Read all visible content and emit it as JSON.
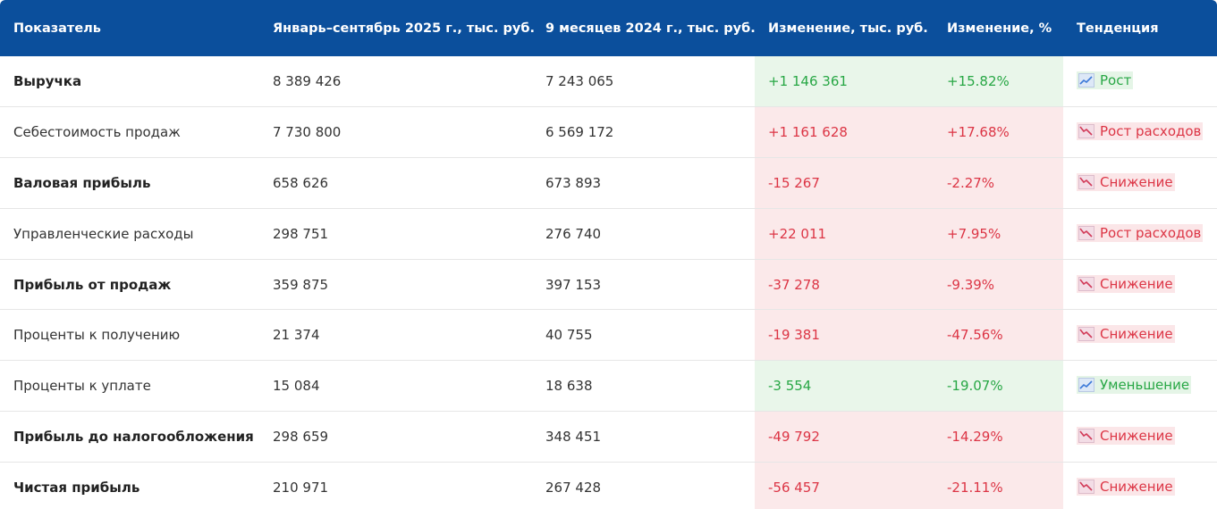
{
  "header": {
    "col_indicator": "Показатель",
    "col_2025": "Январь–сентябрь 2025 г., тыс. руб.",
    "col_2024": "9 месяцев 2024 г., тыс. руб.",
    "col_change_abs": "Изменение, тыс. руб.",
    "col_change_pct": "Изменение, %",
    "col_trend": "Тенденция"
  },
  "rows": [
    {
      "name": "Выручка",
      "bold": true,
      "v2025": "8 389 426",
      "v2024": "7 243 065",
      "abs": "+1 146 361",
      "pct": "+15.82%",
      "trend": "Рост",
      "tone": "up",
      "icon": "chart-increasing-icon"
    },
    {
      "name": "Себестоимость продаж",
      "bold": false,
      "v2025": "7 730 800",
      "v2024": "6 569 172",
      "abs": "+1 161 628",
      "pct": "+17.68%",
      "trend": "Рост расходов",
      "tone": "down",
      "icon": "chart-decreasing-icon"
    },
    {
      "name": "Валовая прибыль",
      "bold": true,
      "v2025": "658 626",
      "v2024": "673 893",
      "abs": "-15 267",
      "pct": "-2.27%",
      "trend": "Снижение",
      "tone": "down",
      "icon": "chart-decreasing-icon"
    },
    {
      "name": "Управленческие расходы",
      "bold": false,
      "v2025": "298 751",
      "v2024": "276 740",
      "abs": "+22 011",
      "pct": "+7.95%",
      "trend": "Рост расходов",
      "tone": "down",
      "icon": "chart-decreasing-icon"
    },
    {
      "name": "Прибыль от продаж",
      "bold": true,
      "v2025": "359 875",
      "v2024": "397 153",
      "abs": "-37 278",
      "pct": "-9.39%",
      "trend": "Снижение",
      "tone": "down",
      "icon": "chart-decreasing-icon"
    },
    {
      "name": "Проценты к получению",
      "bold": false,
      "v2025": "21 374",
      "v2024": "40 755",
      "abs": "-19 381",
      "pct": "-47.56%",
      "trend": "Снижение",
      "tone": "down",
      "icon": "chart-decreasing-icon"
    },
    {
      "name": "Проценты к уплате",
      "bold": false,
      "v2025": "15 084",
      "v2024": "18 638",
      "abs": "-3 554",
      "pct": "-19.07%",
      "trend": "Уменьшение",
      "tone": "up",
      "icon": "chart-increasing-icon"
    },
    {
      "name": "Прибыль до налогообложения",
      "bold": true,
      "v2025": "298 659",
      "v2024": "348 451",
      "abs": "-49 792",
      "pct": "-14.29%",
      "trend": "Снижение",
      "tone": "down",
      "icon": "chart-decreasing-icon"
    },
    {
      "name": "Чистая прибыль",
      "bold": true,
      "v2025": "210 971",
      "v2024": "267 428",
      "abs": "-56 457",
      "pct": "-21.11%",
      "trend": "Снижение",
      "tone": "down",
      "icon": "chart-decreasing-icon"
    }
  ],
  "colors": {
    "header_bg": "#0b4f9c",
    "positive": "#28a745",
    "negative": "#dc3545",
    "positive_bg": "#e9f6ea",
    "negative_bg": "#fbe9ea"
  }
}
